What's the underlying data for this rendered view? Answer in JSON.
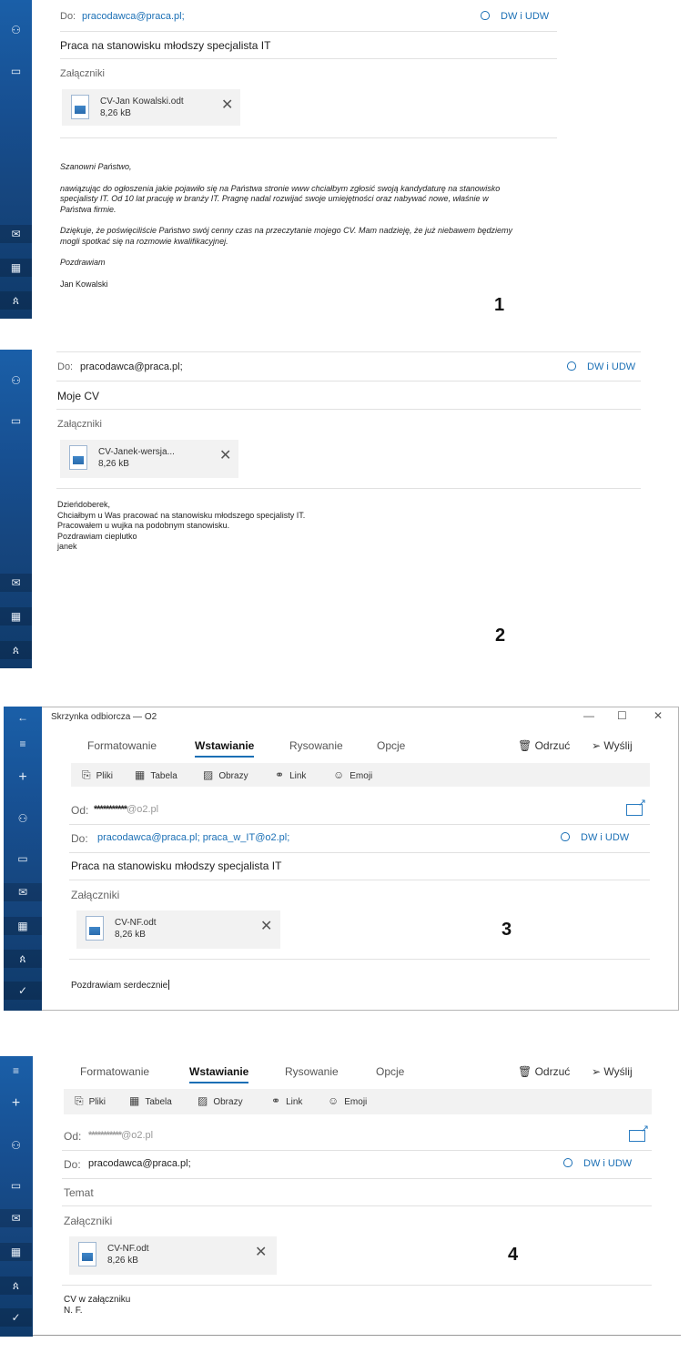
{
  "shared": {
    "rail_colors": [
      "#1a5fa8",
      "#0f3a6a"
    ],
    "accent": "#1a6fb5",
    "x_glyph": "✕",
    "icons": {
      "person": "person-icon",
      "folder": "folder-icon",
      "mail": "mail-icon",
      "calendar": "calendar-icon",
      "people": "people-icon",
      "check": "todo-icon",
      "back": "back-arrow-icon",
      "menu": "hamburger-icon",
      "plus": "new-mail-icon"
    }
  },
  "p1": {
    "to_label": "Do:",
    "to_value": "pracodawca@praca.pl;",
    "cc_label": "DW i UDW",
    "subject": "Praca na stanowisku młodszy specjalista IT",
    "attachments_label": "Załączniki",
    "attachment": {
      "name": "CV-Jan Kowalski.odt",
      "size": "8,26 kB"
    },
    "body": [
      "Szanowni Państwo,",
      "nawiązując do ogłoszenia jakie pojawiło się na Państwa stronie www chciałbym zgłosić swoją kandydaturę na stanowisko",
      "specjalisty IT. Od 10 lat pracuję w branży IT. Pragnę nadal rozwijać swoje umiejętności oraz nabywać nowe, właśnie w",
      "Państwa firmie.",
      "Dziękuje, że poświęciliście Państwo swój cenny czas na przeczytanie mojego CV. Mam nadzieję, że już niebawem będziemy",
      "mogli spotkać się na rozmowie kwalifikacyjnej.",
      "Pozdrawiam",
      "Jan Kowalski"
    ],
    "number": "1"
  },
  "p2": {
    "to_label": "Do:",
    "to_value": "pracodawca@praca.pl;",
    "cc_label": "DW i UDW",
    "subject": "Moje CV",
    "attachments_label": "Załączniki",
    "attachment": {
      "name": "CV-Janek-wersja...",
      "size": "8,26 kB"
    },
    "body": [
      "Dzieńdoberek,",
      "Chciałbym u Was pracować na stanowisku młodszego specjalisty IT.",
      "Pracowałem u wujka na podobnym stanowisku.",
      "Pozdrawiam cieplutko",
      "janek"
    ],
    "number": "2"
  },
  "p3": {
    "window_title": "Skrzynka odbiorcza — O2",
    "window_controls": [
      "—",
      "☐",
      "✕"
    ],
    "tabs": [
      "Formatowanie",
      "Wstawianie",
      "Rysowanie",
      "Opcje"
    ],
    "active_tab": "Wstawianie",
    "discard": "Odrzuć",
    "send": "Wyślij",
    "ribbon": [
      "Pliki",
      "Tabela",
      "Obrazy",
      "Link",
      "Emoji"
    ],
    "from_label": "Od:",
    "from_masked": "***********",
    "from_domain": "@o2.pl",
    "to_label": "Do:",
    "to_value": "pracodawca@praca.pl; praca_w_IT@o2.pl;",
    "cc_label": "DW i UDW",
    "subject": "Praca na stanowisku młodszy specjalista IT",
    "attachments_label": "Załączniki",
    "attachment": {
      "name": "CV-NF.odt",
      "size": "8,26 kB"
    },
    "body": [
      "Pozdrawiam serdecznie"
    ],
    "number": "3"
  },
  "p4": {
    "tabs": [
      "Formatowanie",
      "Wstawianie",
      "Rysowanie",
      "Opcje"
    ],
    "active_tab": "Wstawianie",
    "discard": "Odrzuć",
    "send": "Wyślij",
    "ribbon": [
      "Pliki",
      "Tabela",
      "Obrazy",
      "Link",
      "Emoji"
    ],
    "from_label": "Od:",
    "from_masked": "***********",
    "from_domain": "@o2.pl",
    "to_label": "Do:",
    "to_value": "pracodawca@praca.pl;",
    "cc_label": "DW i UDW",
    "subject_placeholder": "Temat",
    "attachments_label": "Załączniki",
    "attachment": {
      "name": "CV-NF.odt",
      "size": "8,26 kB"
    },
    "body": [
      "CV w załączniku",
      "N. F."
    ],
    "number": "4"
  }
}
